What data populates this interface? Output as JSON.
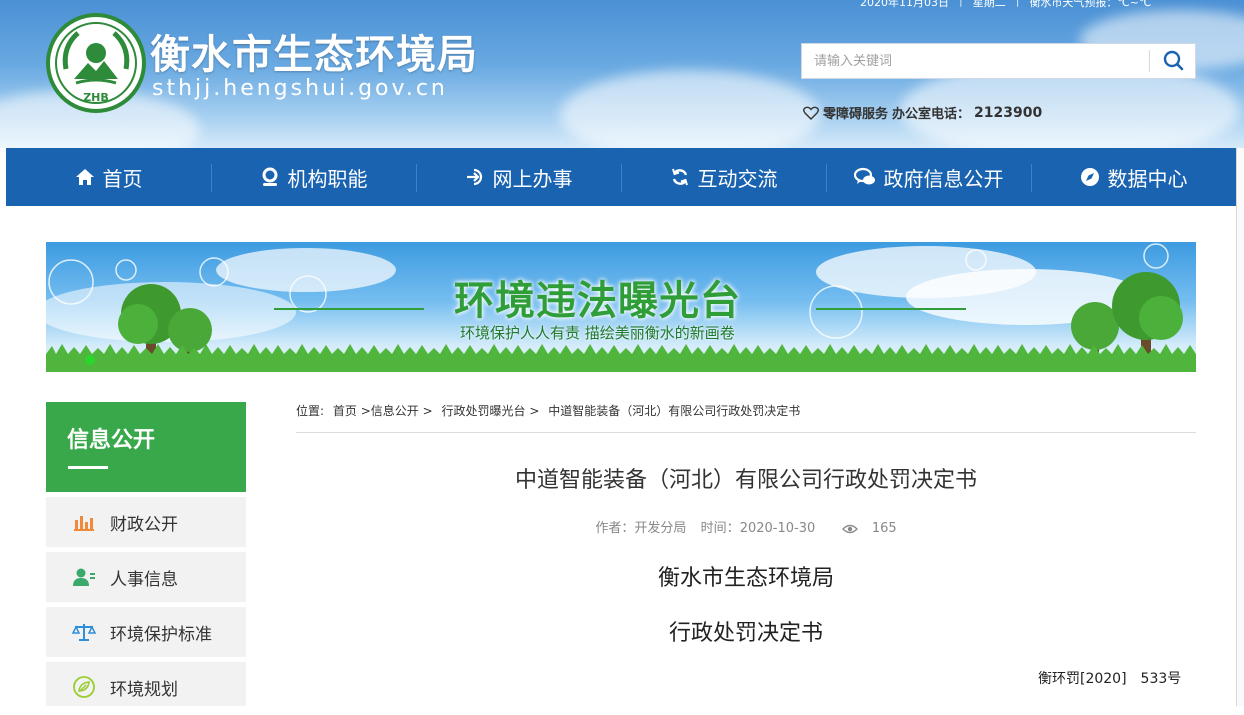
{
  "topbar": {
    "date": "2020年11月03日",
    "weekday": "星期二",
    "weather": "衡水市天气预报：℃~℃"
  },
  "site": {
    "name": "衡水市生态环境局",
    "domain": "sthjj.hengshui.gov.cn",
    "logo_text": "ZHB"
  },
  "search": {
    "placeholder": "请输入关键词",
    "icon": "search-icon"
  },
  "accessibility": {
    "label": "零障碍服务",
    "office_label": "办公室电话：",
    "phone": "2123900"
  },
  "nav": {
    "items": [
      {
        "label": "首页",
        "icon": "home-icon"
      },
      {
        "label": "机构职能",
        "icon": "location-icon"
      },
      {
        "label": "网上办事",
        "icon": "login-icon"
      },
      {
        "label": "互动交流",
        "icon": "refresh-icon"
      },
      {
        "label": "政府信息公开",
        "icon": "chat-icon"
      },
      {
        "label": "数据中心",
        "icon": "compass-icon"
      }
    ]
  },
  "banner": {
    "title": "环境违法曝光台",
    "subtitle": "环境保护人人有责 描绘美丽衡水的新画卷"
  },
  "sidebar": {
    "title": "信息公开",
    "items": [
      {
        "label": "财政公开",
        "icon": "bar-chart-icon"
      },
      {
        "label": "人事信息",
        "icon": "person-icon"
      },
      {
        "label": "环境保护标准",
        "icon": "scale-icon"
      },
      {
        "label": "环境规划",
        "icon": "leaf-icon"
      }
    ]
  },
  "breadcrumb": {
    "prefix": "位置:",
    "items": [
      "首页",
      ">信息公开",
      ">",
      "行政处罚曝光台",
      ">",
      "中道智能装备（河北）有限公司行政处罚决定书"
    ]
  },
  "article": {
    "title": "中道智能装备（河北）有限公司行政处罚决定书",
    "author_label": "作者：",
    "author": "开发分局",
    "time_label": "时间：",
    "time": "2020-10-30",
    "views": "165",
    "line1": "衡水市生态环境局",
    "line2": "行政处罚决定书",
    "doc_no": "衡环罚[2020]　533号"
  },
  "colors": {
    "nav_blue": "#1a63b0",
    "green": "#38a84a",
    "banner_green": "#2f9d38"
  }
}
